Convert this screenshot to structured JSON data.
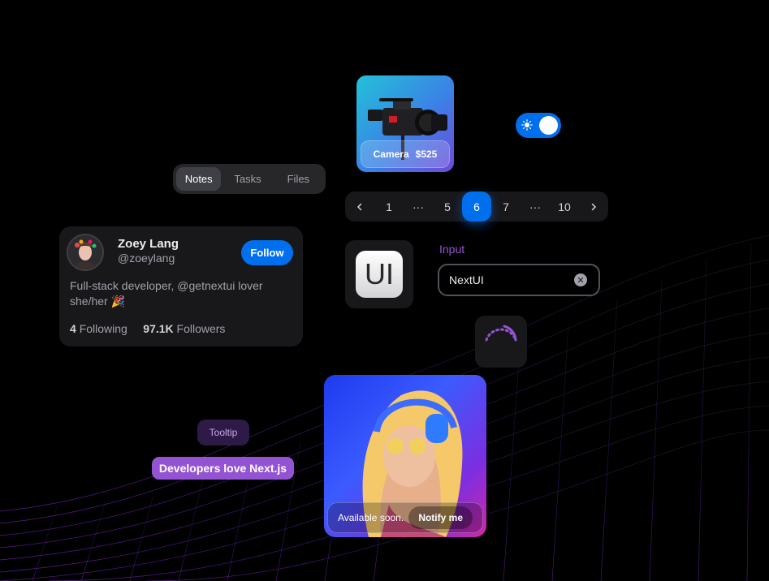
{
  "camera_card": {
    "title": "Camera",
    "price": "$525"
  },
  "theme_switch": {
    "state": "on"
  },
  "tabs": [
    {
      "label": "Notes",
      "active": true
    },
    {
      "label": "Tasks",
      "active": false
    },
    {
      "label": "Files",
      "active": false
    }
  ],
  "pagination": {
    "items": [
      "1",
      "···",
      "5",
      "6",
      "7",
      "···",
      "10"
    ],
    "current": "6"
  },
  "profile": {
    "name": "Zoey Lang",
    "handle": "@zoeylang",
    "follow_label": "Follow",
    "bio": "Full-stack developer, @getnextui lover she/her 🎉",
    "following_count": "4",
    "following_label": "Following",
    "followers_count": "97.1K",
    "followers_label": "Followers"
  },
  "logo": {
    "text": "UI"
  },
  "input": {
    "label": "Input",
    "value": "NextUI"
  },
  "tooltip": {
    "text": "Tooltip"
  },
  "chip": {
    "text": "Developers love Next.js"
  },
  "promo_card": {
    "availability": "Available soon.",
    "notify_label": "Notify me"
  },
  "colors": {
    "primary": "#006fee",
    "secondary": "#9353d3",
    "background": "#000000",
    "surface": "#18181b"
  }
}
